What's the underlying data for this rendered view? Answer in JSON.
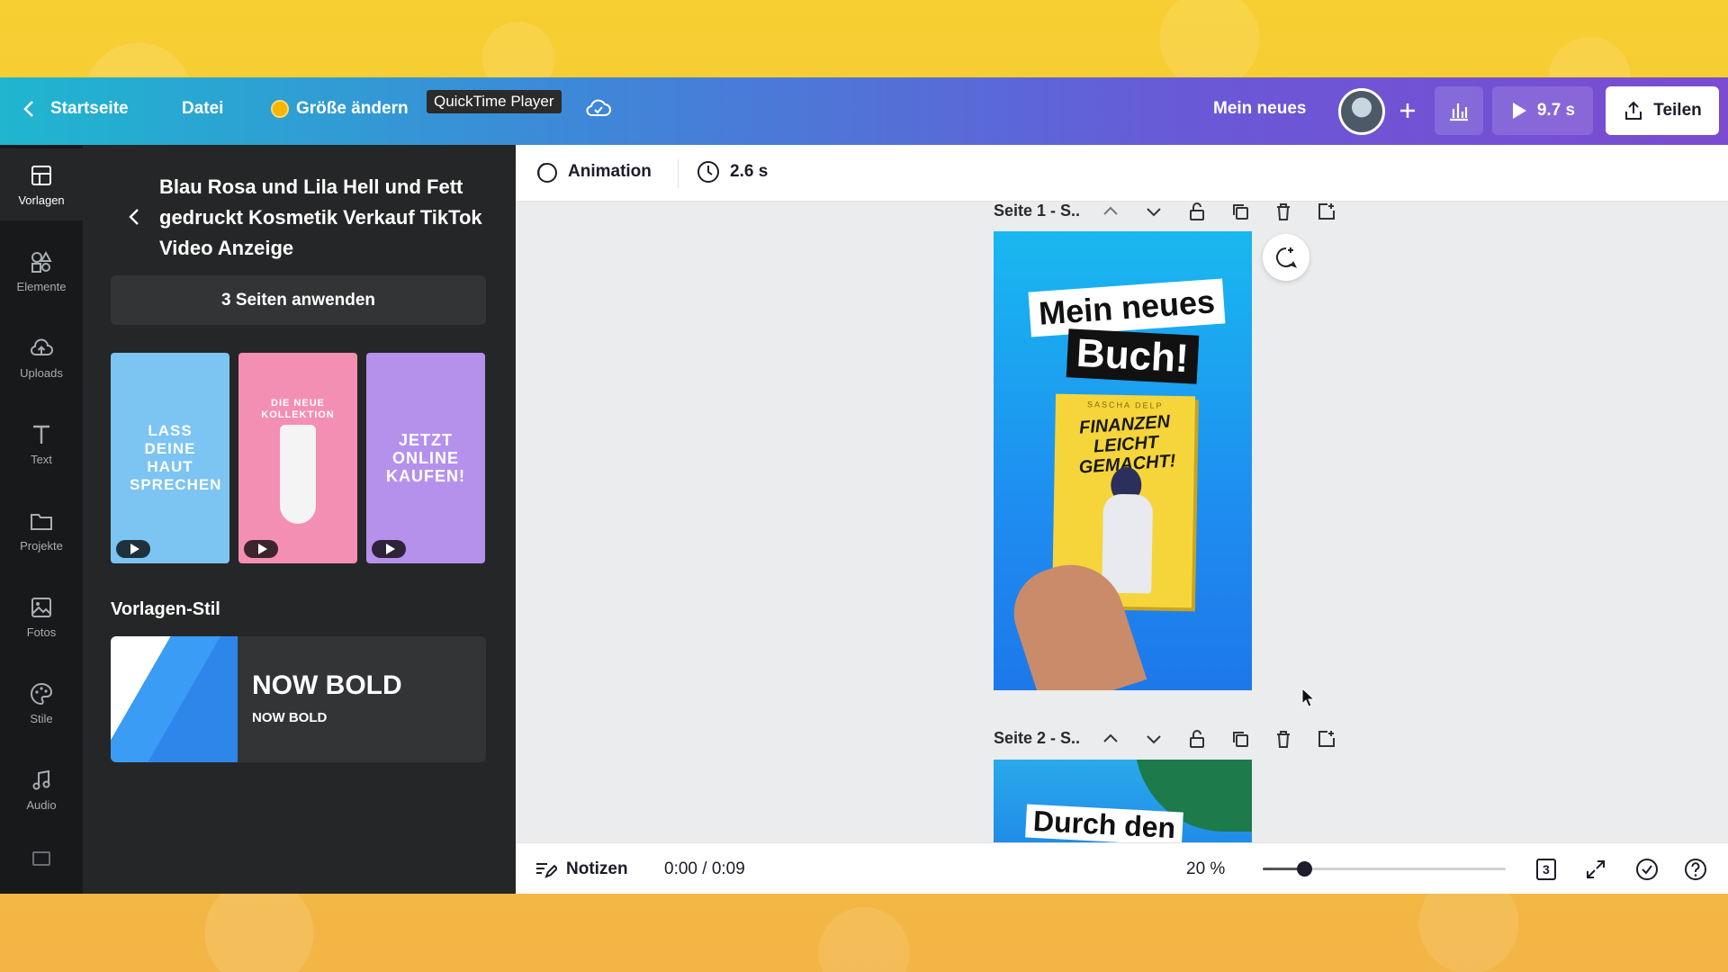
{
  "header": {
    "back_label": "Startseite",
    "file_label": "Datei",
    "resize_label": "Größe ändern",
    "tooltip": "QuickTime Player",
    "doc_title": "Mein neues",
    "play_duration": "9.7 s",
    "share_label": "Teilen"
  },
  "rail": {
    "items": [
      {
        "label": "Vorlagen",
        "icon": "templates-icon"
      },
      {
        "label": "Elemente",
        "icon": "elements-icon"
      },
      {
        "label": "Uploads",
        "icon": "upload-cloud-icon"
      },
      {
        "label": "Text",
        "icon": "text-icon"
      },
      {
        "label": "Projekte",
        "icon": "folder-icon"
      },
      {
        "label": "Fotos",
        "icon": "photo-icon"
      },
      {
        "label": "Stile",
        "icon": "palette-icon"
      },
      {
        "label": "Audio",
        "icon": "music-note-icon"
      }
    ]
  },
  "panel": {
    "title": "Blau Rosa und Lila Hell und Fett gedruckt Kosmetik Verkauf TikTok Video Anzeige",
    "apply_label": "3 Seiten anwenden",
    "thumbnails": [
      {
        "text": "LASS DEINE HAUT SPRECHEN",
        "color": "#7cc4f2"
      },
      {
        "text": "DIE NEUE KOLLEKTION",
        "color": "#f38fb3"
      },
      {
        "text": "JETZT ONLINE KAUFEN!",
        "color": "#b591ec"
      }
    ],
    "style_heading": "Vorlagen-Stil",
    "style_name": "NOW BOLD",
    "style_sub": "NOW BOLD"
  },
  "toolbar": {
    "animation_label": "Animation",
    "duration": "2.6 s"
  },
  "canvas": {
    "page1_label": "Seite 1 - S..",
    "page2_label": "Seite 2 - S..",
    "design1": {
      "headline1": "Mein neues",
      "headline2": "Buch!",
      "book_author": "SASCHA DELP",
      "book_title": "FINANZEN LEICHT GEMACHT!"
    },
    "design2": {
      "headline": "Durch den"
    }
  },
  "bottombar": {
    "notes_label": "Notizen",
    "time": "0:00 / 0:09",
    "zoom": "20 %",
    "page_count": "3"
  },
  "colors": {
    "accent_start": "#1fb6cf",
    "accent_end": "#7b4bd0",
    "panel_bg": "#252627",
    "rail_bg": "#18191b"
  }
}
